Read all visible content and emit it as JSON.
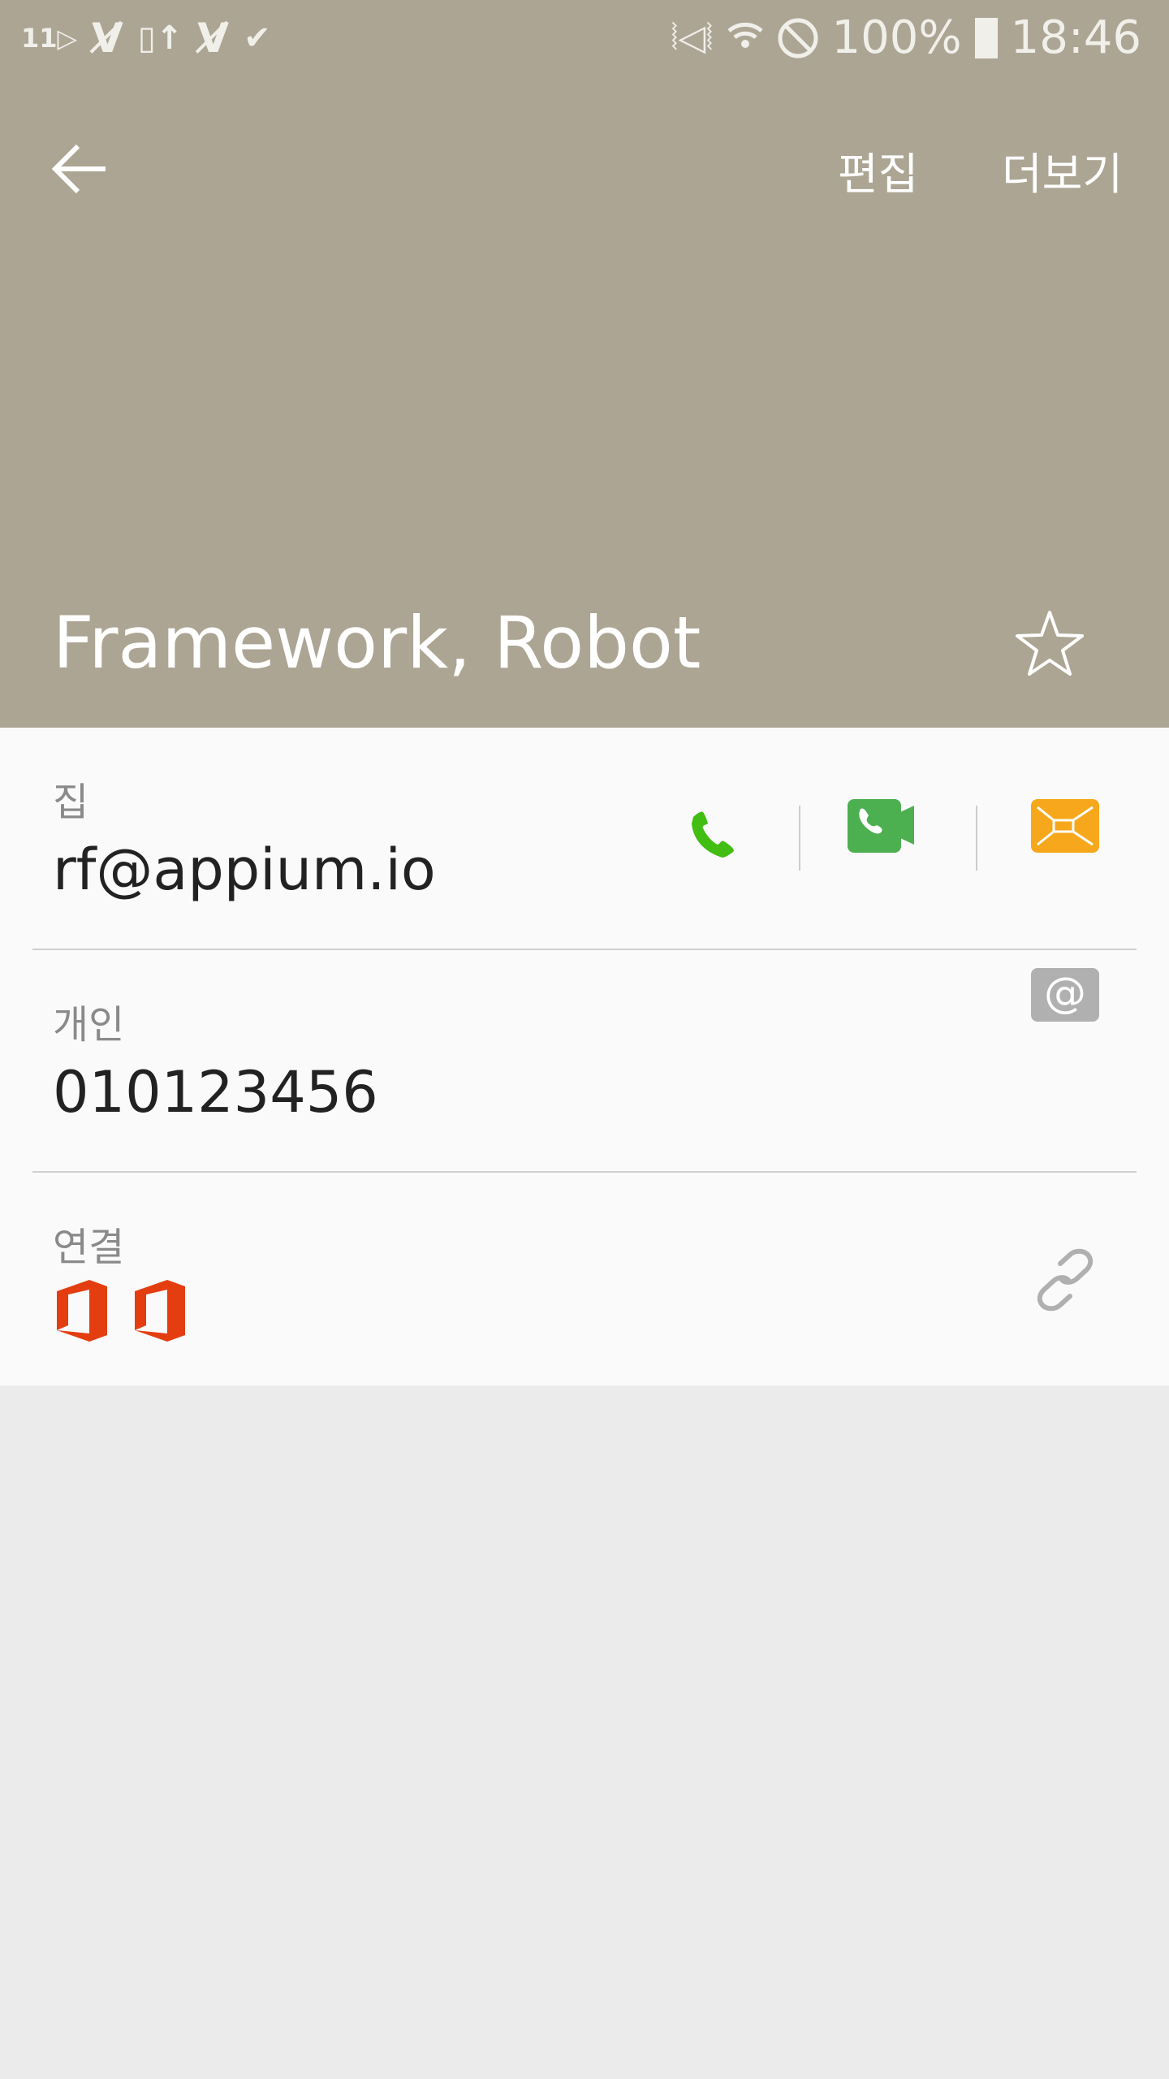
{
  "status_bar": {
    "battery": "100%",
    "time": "18:46",
    "notification_icons": [
      "sim-11-icon",
      "vs-icon",
      "phone-upload-icon",
      "vs-icon",
      "check-icon"
    ],
    "system_icons": [
      "vibrate-mute-icon",
      "wifi-icon",
      "do-not-disturb-icon",
      "battery-icon"
    ]
  },
  "header": {
    "edit_label": "편집",
    "more_label": "더보기",
    "contact_name": "Framework, Robot",
    "background_color": "#aca594"
  },
  "rows": [
    {
      "label": "집",
      "value": "rf@appium.io",
      "actions": [
        "phone-icon",
        "video-call-icon",
        "message-icon"
      ]
    },
    {
      "label": "개인",
      "value": "010123456",
      "actions": [
        "email-at-icon"
      ]
    },
    {
      "label": "연결",
      "linked_accounts": [
        "office-icon",
        "office-icon"
      ],
      "actions": [
        "link-icon"
      ]
    }
  ],
  "colors": {
    "call": "#42be12",
    "video": "#4caf50",
    "message": "#f7a71b",
    "email": "#b0b0b0",
    "office": "#e43d10"
  }
}
